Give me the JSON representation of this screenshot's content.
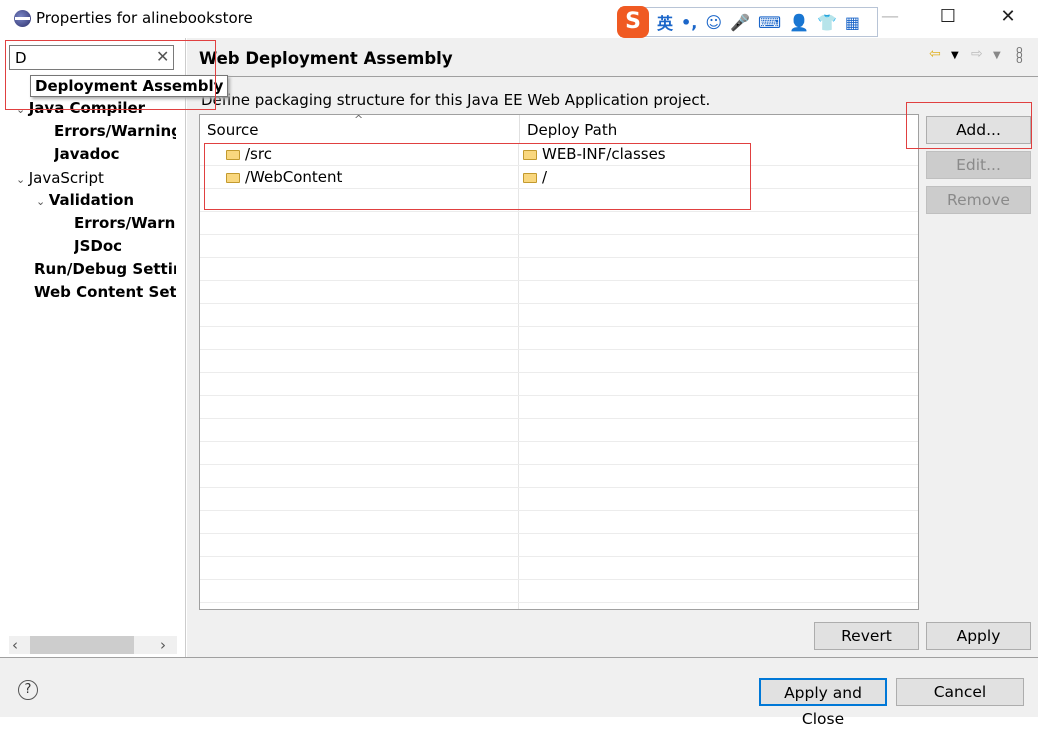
{
  "window": {
    "title": "Properties for alinebookstore",
    "minimize": "—",
    "maximize": "☐",
    "close": "✕"
  },
  "ime": {
    "logo": "S",
    "items": [
      "英",
      "•,",
      "☺",
      "🎤",
      "⌨",
      "👤",
      "👕",
      "▦"
    ]
  },
  "sidebar": {
    "filter_value": "D",
    "clear_icon": "✕",
    "tooltip": "Deployment Assembly",
    "items": [
      {
        "label": "Java Compiler",
        "expanded": true
      },
      {
        "label": "Errors/Warnings"
      },
      {
        "label": "Javadoc"
      },
      {
        "label": "JavaScript",
        "expanded": true
      },
      {
        "label": "Validation",
        "expanded": true
      },
      {
        "label": "Errors/Warnings"
      },
      {
        "label": "JSDoc"
      },
      {
        "label": "Run/Debug Settings"
      },
      {
        "label": "Web Content Settings"
      }
    ],
    "scroll_left": "‹",
    "scroll_right": "›"
  },
  "main": {
    "title": "Web Deployment Assembly",
    "description": "Define packaging structure for this Java EE Web Application project.",
    "columns": [
      "Source",
      "Deploy Path"
    ],
    "rows": [
      {
        "source": "/src",
        "deploy_path": "WEB-INF/classes"
      },
      {
        "source": "/WebContent",
        "deploy_path": "/"
      }
    ],
    "buttons": {
      "add": "Add...",
      "edit": "Edit...",
      "remove": "Remove",
      "revert": "Revert",
      "apply": "Apply"
    }
  },
  "footer": {
    "help": "?",
    "apply_close": "Apply and Close",
    "cancel": "Cancel"
  },
  "colors": {
    "highlight_red": "#e04040",
    "focus_blue": "#0078d7"
  }
}
